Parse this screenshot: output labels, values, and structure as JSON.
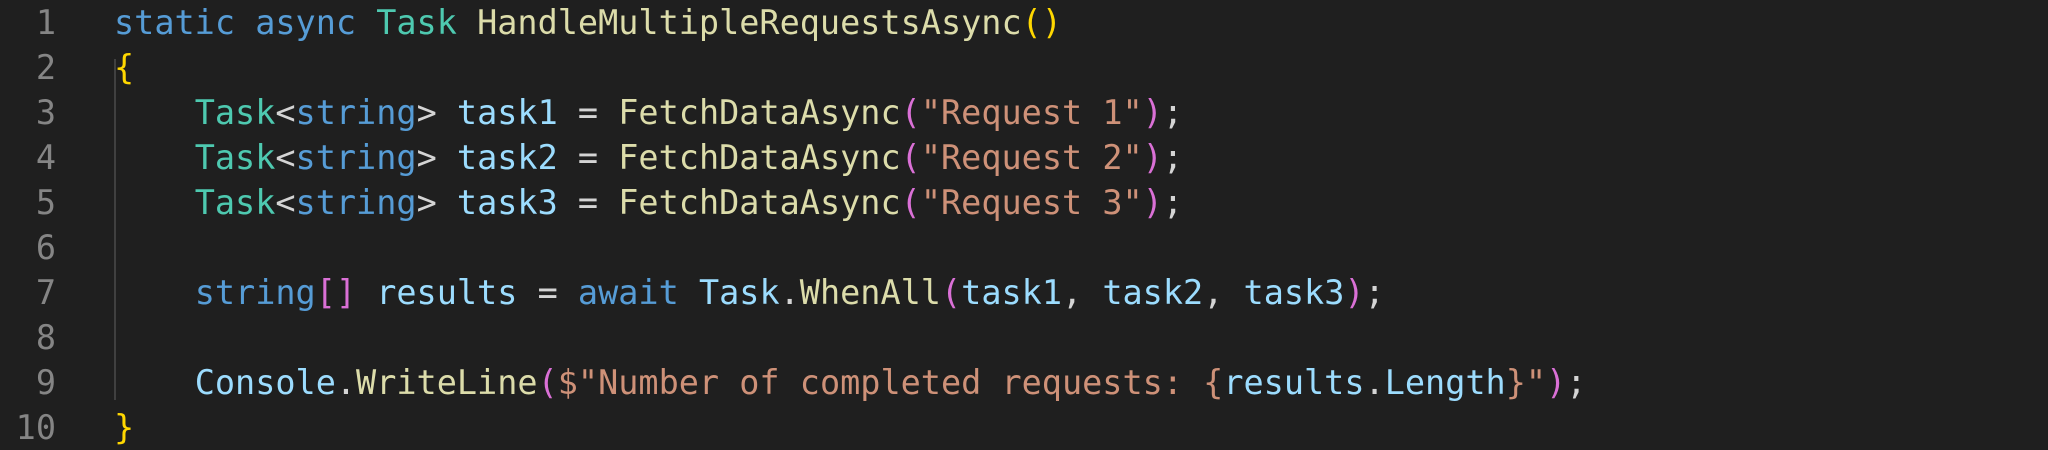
{
  "editor": {
    "line_numbers": [
      "1",
      "2",
      "3",
      "4",
      "5",
      "6",
      "7",
      "8",
      "9",
      "10"
    ],
    "lines": [
      [
        {
          "t": "static",
          "c": "kw"
        },
        {
          "t": " ",
          "c": "pun"
        },
        {
          "t": "async",
          "c": "kw"
        },
        {
          "t": " ",
          "c": "pun"
        },
        {
          "t": "Task",
          "c": "ty"
        },
        {
          "t": " ",
          "c": "pun"
        },
        {
          "t": "HandleMultipleRequestsAsync",
          "c": "fn"
        },
        {
          "t": "()",
          "c": "br1"
        }
      ],
      [
        {
          "t": "{",
          "c": "br1"
        }
      ],
      [
        {
          "t": "    ",
          "c": "pun"
        },
        {
          "t": "Task",
          "c": "ty"
        },
        {
          "t": "<",
          "c": "pun"
        },
        {
          "t": "string",
          "c": "kw"
        },
        {
          "t": "> ",
          "c": "pun"
        },
        {
          "t": "task1",
          "c": "var"
        },
        {
          "t": " = ",
          "c": "pun"
        },
        {
          "t": "FetchDataAsync",
          "c": "fn"
        },
        {
          "t": "(",
          "c": "br2"
        },
        {
          "t": "\"Request 1\"",
          "c": "str"
        },
        {
          "t": ")",
          "c": "br2"
        },
        {
          "t": ";",
          "c": "pun"
        }
      ],
      [
        {
          "t": "    ",
          "c": "pun"
        },
        {
          "t": "Task",
          "c": "ty"
        },
        {
          "t": "<",
          "c": "pun"
        },
        {
          "t": "string",
          "c": "kw"
        },
        {
          "t": "> ",
          "c": "pun"
        },
        {
          "t": "task2",
          "c": "var"
        },
        {
          "t": " = ",
          "c": "pun"
        },
        {
          "t": "FetchDataAsync",
          "c": "fn"
        },
        {
          "t": "(",
          "c": "br2"
        },
        {
          "t": "\"Request 2\"",
          "c": "str"
        },
        {
          "t": ")",
          "c": "br2"
        },
        {
          "t": ";",
          "c": "pun"
        }
      ],
      [
        {
          "t": "    ",
          "c": "pun"
        },
        {
          "t": "Task",
          "c": "ty"
        },
        {
          "t": "<",
          "c": "pun"
        },
        {
          "t": "string",
          "c": "kw"
        },
        {
          "t": "> ",
          "c": "pun"
        },
        {
          "t": "task3",
          "c": "var"
        },
        {
          "t": " = ",
          "c": "pun"
        },
        {
          "t": "FetchDataAsync",
          "c": "fn"
        },
        {
          "t": "(",
          "c": "br2"
        },
        {
          "t": "\"Request 3\"",
          "c": "str"
        },
        {
          "t": ")",
          "c": "br2"
        },
        {
          "t": ";",
          "c": "pun"
        }
      ],
      [],
      [
        {
          "t": "    ",
          "c": "pun"
        },
        {
          "t": "string",
          "c": "kw"
        },
        {
          "t": "[]",
          "c": "br2"
        },
        {
          "t": " ",
          "c": "pun"
        },
        {
          "t": "results",
          "c": "var"
        },
        {
          "t": " = ",
          "c": "pun"
        },
        {
          "t": "await",
          "c": "kw"
        },
        {
          "t": " ",
          "c": "pun"
        },
        {
          "t": "Task",
          "c": "var"
        },
        {
          "t": ".",
          "c": "pun"
        },
        {
          "t": "WhenAll",
          "c": "fn"
        },
        {
          "t": "(",
          "c": "br2"
        },
        {
          "t": "task1",
          "c": "var"
        },
        {
          "t": ", ",
          "c": "pun"
        },
        {
          "t": "task2",
          "c": "var"
        },
        {
          "t": ", ",
          "c": "pun"
        },
        {
          "t": "task3",
          "c": "var"
        },
        {
          "t": ")",
          "c": "br2"
        },
        {
          "t": ";",
          "c": "pun"
        }
      ],
      [],
      [
        {
          "t": "    ",
          "c": "pun"
        },
        {
          "t": "Console",
          "c": "var"
        },
        {
          "t": ".",
          "c": "pun"
        },
        {
          "t": "WriteLine",
          "c": "fn"
        },
        {
          "t": "(",
          "c": "br2"
        },
        {
          "t": "$\"Number of completed requests: ",
          "c": "str"
        },
        {
          "t": "{",
          "c": "str"
        },
        {
          "t": "results",
          "c": "var"
        },
        {
          "t": ".",
          "c": "pun"
        },
        {
          "t": "Length",
          "c": "var"
        },
        {
          "t": "}",
          "c": "str"
        },
        {
          "t": "\"",
          "c": "str"
        },
        {
          "t": ")",
          "c": "br2"
        },
        {
          "t": ";",
          "c": "pun"
        }
      ],
      [
        {
          "t": "}",
          "c": "br1"
        }
      ]
    ]
  }
}
